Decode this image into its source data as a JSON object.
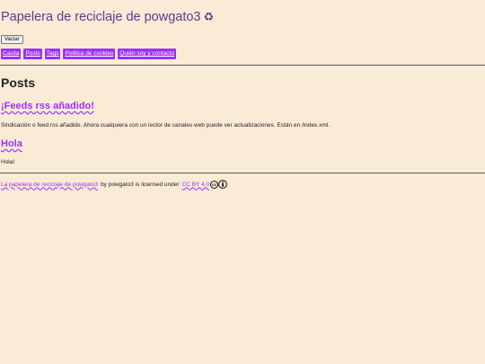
{
  "site": {
    "title": "Papelera de reciclaje de powgato3",
    "title_icon": "♻"
  },
  "actions": {
    "vaciar_label": "Vaciar"
  },
  "nav": {
    "items": [
      {
        "label": "Casita"
      },
      {
        "label": "Posts"
      },
      {
        "label": "Tags"
      },
      {
        "label": "Politica de cookies"
      },
      {
        "label": "Quién soy y contacto"
      }
    ]
  },
  "main": {
    "heading": "Posts",
    "posts": [
      {
        "title": "¡Feeds rss añadido!",
        "excerpt": "Sindicación o feed rss añadido. Ahora cualquiera con un lector de canales web puede ver actualizaciones. Están en /index.xml."
      },
      {
        "title": "Hola",
        "excerpt": "Hola!"
      }
    ]
  },
  "footer": {
    "work_link": "La papelera de reciclaje de powgato3",
    "by_text": "by powgato3 is licensed under",
    "license_link": "CC BY 4.0",
    "cc_icon_text": "cc"
  },
  "colors": {
    "background": "#faebd7",
    "title": "#5b3b8c",
    "accent": "#9b30ff",
    "text": "#222222"
  }
}
